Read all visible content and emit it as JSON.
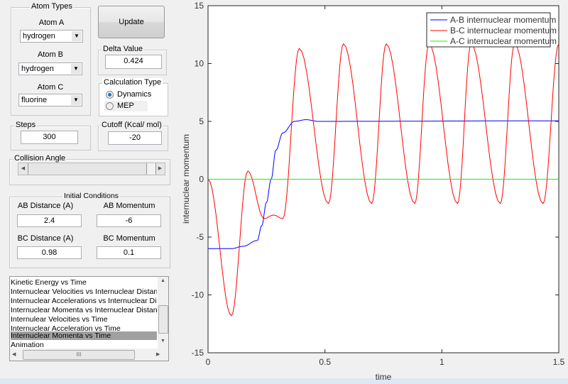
{
  "atom_types": {
    "title": "Atom Types",
    "atom_a_label": "Atom A",
    "atom_a": "hydrogen",
    "atom_b_label": "Atom B",
    "atom_b": "hydrogen",
    "atom_c_label": "Atom C",
    "atom_c": "fluorine"
  },
  "update_label": "Update",
  "delta": {
    "title": "Delta Value",
    "value": "0.424"
  },
  "calc_type": {
    "title": "Calculation Type",
    "options": [
      "Dynamics",
      "MEP"
    ],
    "selected": "Dynamics"
  },
  "steps": {
    "title": "Steps",
    "value": "300"
  },
  "cutoff": {
    "title": "Cutoff (Kcal/ mol)",
    "value": "-20"
  },
  "collision_angle": {
    "title": "Collision Angle",
    "slider_fraction": 0.92
  },
  "initial": {
    "title": "Initial Conditions",
    "ab_dist_label": "AB Distance (A)",
    "ab_dist": "2.4",
    "ab_mom_label": "AB Momentum",
    "ab_mom": "-6",
    "bc_dist_label": "BC Distance (A)",
    "bc_dist": "0.98",
    "bc_mom_label": "BC Momentum",
    "bc_mom": "0.1"
  },
  "plot_list": {
    "items": [
      "Kinetic Energy vs Time",
      "Internuclear Velocities vs Internuclear Distance",
      "Internuclear Accelerations vs Internuclear Distance",
      "Internuclear Momenta vs Internuclear Distance",
      "Internulear Velocities vs Time",
      "Internuclear Acceleration vs Time",
      "Internuclear Momenta vs Time",
      "Animation"
    ],
    "selected_index": 6,
    "scroll_glyph": "III"
  },
  "chart_data": {
    "type": "line",
    "title": "",
    "xlabel": "time",
    "ylabel": "internuclear momentum",
    "xlim": [
      0,
      1.5
    ],
    "ylim": [
      -15,
      15
    ],
    "xticks": [
      "0",
      "0.5",
      "1",
      "1.5"
    ],
    "yticks": [
      "-15",
      "-10",
      "-5",
      "0",
      "5",
      "10",
      "15"
    ],
    "legend_position": "top-right",
    "grid": false,
    "series": [
      {
        "name": "A-B internuclear momentum",
        "color": "#0000ff",
        "x": [
          0,
          0.1,
          0.15,
          0.21,
          0.23,
          0.25,
          0.27,
          0.29,
          0.32,
          0.37,
          0.42,
          0.47,
          1.5
        ],
        "y": [
          -6,
          -6,
          -5.8,
          -5.3,
          -4,
          -2,
          0,
          2.5,
          4,
          5,
          5.15,
          5.0,
          5.05
        ]
      },
      {
        "name": "B-C internuclear momentum",
        "color": "#ff0000",
        "x": [
          0,
          0.1,
          0.17,
          0.24,
          0.28,
          0.32,
          0.39,
          0.515,
          0.579,
          0.7,
          0.762,
          0.884,
          0.945,
          1.067,
          1.125,
          1.25,
          1.311,
          1.433,
          1.5
        ],
        "y": [
          0,
          -11.8,
          0.7,
          -3.4,
          -3.1,
          -3.4,
          11.3,
          -2.1,
          11.7,
          -2.1,
          11.7,
          -2.1,
          11.7,
          -2.1,
          11.7,
          -2.1,
          11.7,
          -2.1,
          11.7
        ]
      },
      {
        "name": "A-C internuclear momentum",
        "color": "#00ff00",
        "x": [
          0,
          1.5
        ],
        "y": [
          0,
          0
        ]
      }
    ]
  }
}
